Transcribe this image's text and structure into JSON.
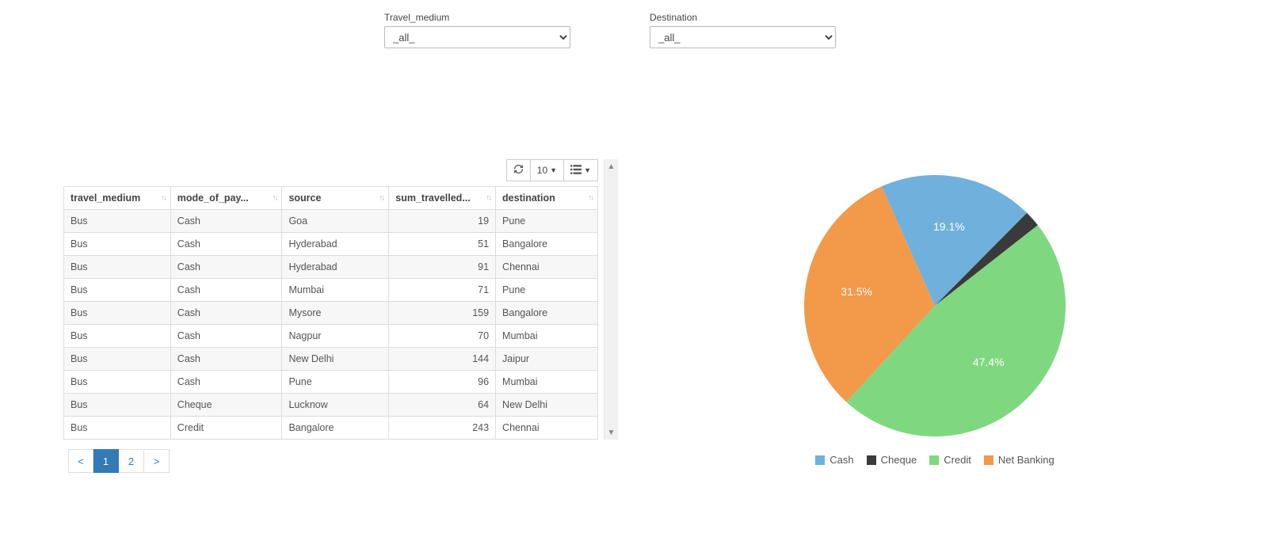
{
  "filters": {
    "travel_medium": {
      "label": "Travel_medium",
      "value": "_all_"
    },
    "destination": {
      "label": "Destination",
      "value": "_all_"
    }
  },
  "toolbar": {
    "page_size": "10"
  },
  "table": {
    "headers": {
      "travel_medium": "travel_medium",
      "mode_of_pay": "mode_of_pay...",
      "source": "source",
      "sum_travelled": "sum_travelled...",
      "destination": "destination"
    },
    "rows": [
      {
        "travel_medium": "Bus",
        "mode_of_pay": "Cash",
        "source": "Goa",
        "sum_travelled": 19,
        "destination": "Pune"
      },
      {
        "travel_medium": "Bus",
        "mode_of_pay": "Cash",
        "source": "Hyderabad",
        "sum_travelled": 51,
        "destination": "Bangalore"
      },
      {
        "travel_medium": "Bus",
        "mode_of_pay": "Cash",
        "source": "Hyderabad",
        "sum_travelled": 91,
        "destination": "Chennai"
      },
      {
        "travel_medium": "Bus",
        "mode_of_pay": "Cash",
        "source": "Mumbai",
        "sum_travelled": 71,
        "destination": "Pune"
      },
      {
        "travel_medium": "Bus",
        "mode_of_pay": "Cash",
        "source": "Mysore",
        "sum_travelled": 159,
        "destination": "Bangalore"
      },
      {
        "travel_medium": "Bus",
        "mode_of_pay": "Cash",
        "source": "Nagpur",
        "sum_travelled": 70,
        "destination": "Mumbai"
      },
      {
        "travel_medium": "Bus",
        "mode_of_pay": "Cash",
        "source": "New Delhi",
        "sum_travelled": 144,
        "destination": "Jaipur"
      },
      {
        "travel_medium": "Bus",
        "mode_of_pay": "Cash",
        "source": "Pune",
        "sum_travelled": 96,
        "destination": "Mumbai"
      },
      {
        "travel_medium": "Bus",
        "mode_of_pay": "Cheque",
        "source": "Lucknow",
        "sum_travelled": 64,
        "destination": "New Delhi"
      },
      {
        "travel_medium": "Bus",
        "mode_of_pay": "Credit",
        "source": "Bangalore",
        "sum_travelled": 243,
        "destination": "Chennai"
      }
    ]
  },
  "pager": {
    "prev": "<",
    "next": ">",
    "pages": [
      "1",
      "2"
    ],
    "active": "1"
  },
  "chart_data": {
    "type": "pie",
    "series": [
      {
        "name": "Cash",
        "value": 19.1,
        "color": "#6fb1dc"
      },
      {
        "name": "Cheque",
        "value": 2.0,
        "color": "#3a3a3a"
      },
      {
        "name": "Credit",
        "value": 47.4,
        "color": "#7fd87f"
      },
      {
        "name": "Net Banking",
        "value": 31.5,
        "color": "#f2994a"
      }
    ],
    "labels_shown": [
      "19.1%",
      "47.4%",
      "31.5%"
    ]
  },
  "legend": {
    "cash": "Cash",
    "cheque": "Cheque",
    "credit": "Credit",
    "netbanking": "Net Banking"
  }
}
